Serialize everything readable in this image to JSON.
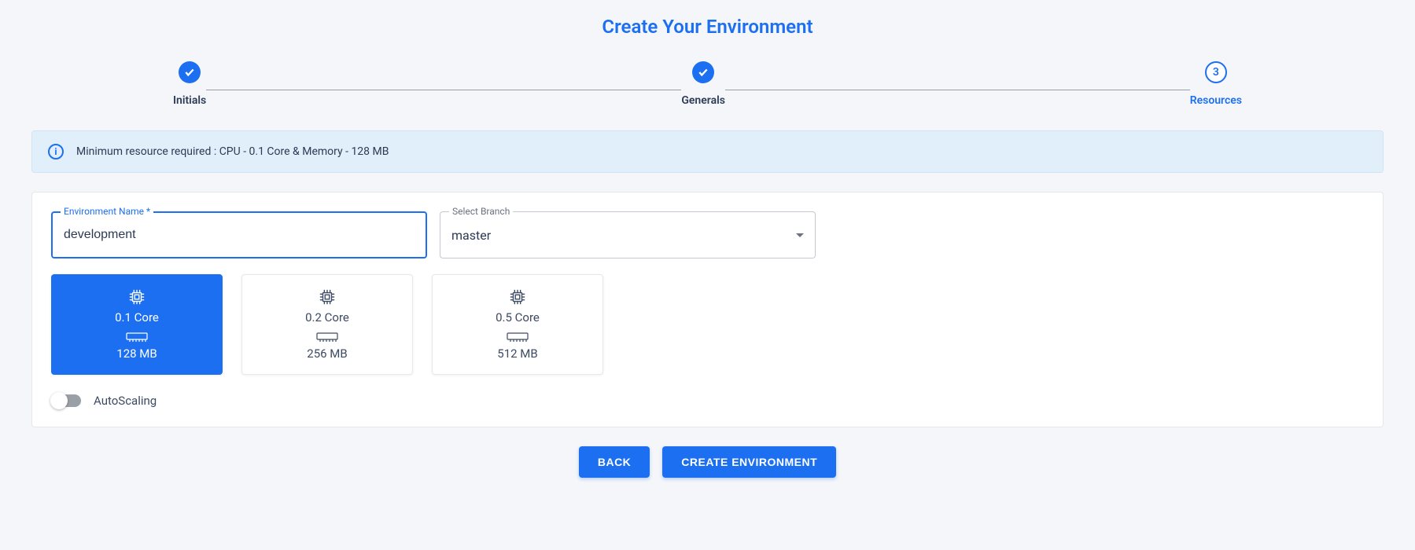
{
  "title": "Create Your Environment",
  "stepper": {
    "step1": {
      "label": "Initials"
    },
    "step2": {
      "label": "Generals"
    },
    "step3": {
      "number": "3",
      "label": "Resources"
    }
  },
  "info_banner": "Minimum resource required : CPU - 0.1 Core & Memory - 128 MB",
  "form": {
    "env_name_label": "Environment Name *",
    "env_name_value": "development",
    "branch_label": "Select Branch",
    "branch_value": "master"
  },
  "resources": [
    {
      "cpu": "0.1 Core",
      "mem": "128 MB",
      "selected": true
    },
    {
      "cpu": "0.2 Core",
      "mem": "256 MB",
      "selected": false
    },
    {
      "cpu": "0.5 Core",
      "mem": "512 MB",
      "selected": false
    }
  ],
  "autoscaling_label": "AutoScaling",
  "buttons": {
    "back": "Back",
    "create": "Create Environment"
  }
}
